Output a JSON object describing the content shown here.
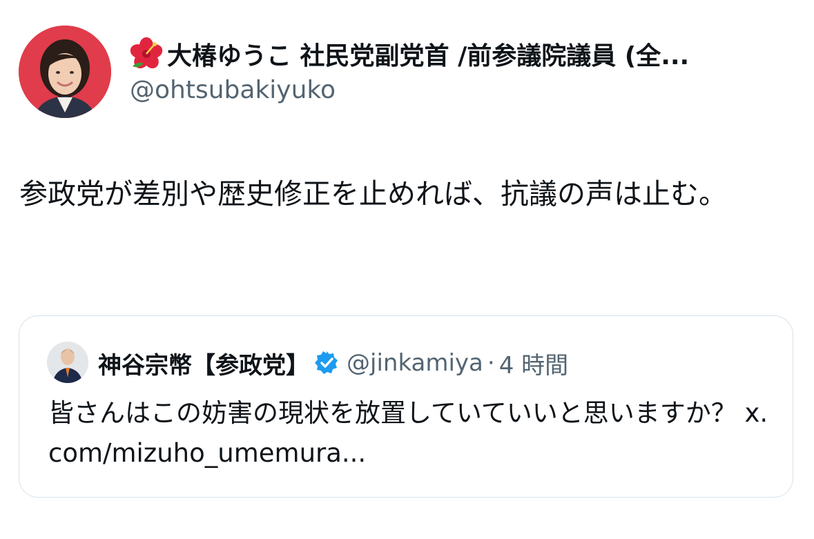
{
  "author": {
    "display_name": "大椿ゆうこ 社民党副党首 /前参議院議員 (全...",
    "handle": "@ohtsubakiyuko",
    "name_icon": "hibiscus-icon"
  },
  "tweet": {
    "text": "参政党が差別や歴史修正を止めれば、抗議の声は止む。"
  },
  "quoted_tweet": {
    "author_name": "神谷宗幣【参政党】",
    "verified_icon": "verified-badge-icon",
    "handle": "@jinkamiya",
    "separator": "·",
    "time": "4 時間",
    "text": "皆さんはこの妨害の現状を放置していていいと思いますか？ x.com/mizuho_umemura..."
  },
  "colors": {
    "text_primary": "#0f1419",
    "text_secondary": "#536471",
    "verified_blue": "#1d9bf0",
    "avatar_bg": "#e03c4b",
    "card_border": "#d6e2ea"
  }
}
